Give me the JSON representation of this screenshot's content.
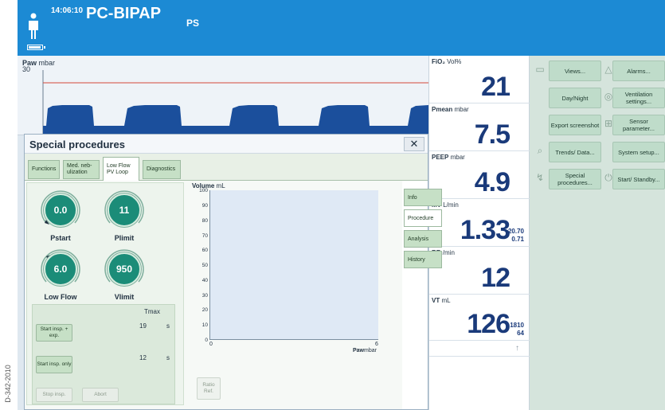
{
  "side_caption": "D-342-2010",
  "header": {
    "time": "14:06:10",
    "mode": "PC-BIPAP",
    "sub_mode": "PS"
  },
  "curve": {
    "param": "Paw",
    "unit": "mbar",
    "scale_max": "30",
    "limit_color": "#d44a3a",
    "wave_color": "#1b4f9c"
  },
  "values": [
    {
      "param": "FiO₂",
      "unit": "Vol%",
      "value": "21",
      "small": []
    },
    {
      "param": "Pmean",
      "unit": "mbar",
      "value": "7.5",
      "small": []
    },
    {
      "param": "PEEP",
      "unit": "mbar",
      "value": "4.9",
      "small": []
    },
    {
      "param": "MV",
      "unit": "L/min",
      "value": "1.33",
      "small": [
        "20.70",
        "0.71"
      ]
    },
    {
      "param": "RR",
      "unit": "/min",
      "value": "12",
      "small": []
    },
    {
      "param": "VT",
      "unit": "mL",
      "value": "126",
      "small": [
        "1810",
        "64"
      ]
    }
  ],
  "values_arrow": "↑",
  "right_panel": {
    "buttons": [
      {
        "label": "Views...",
        "icon": "views-icon"
      },
      {
        "label": "Alarms...",
        "icon": "alarm-icon"
      },
      {
        "label": "Day/Night",
        "icon": ""
      },
      {
        "label": "Ventilation settings...",
        "icon": "ventilation-icon"
      },
      {
        "label": "Export screenshot",
        "icon": ""
      },
      {
        "label": "Sensor parameter...",
        "icon": "sensor-icon"
      },
      {
        "label": "Trends/ Data...",
        "icon": "trends-icon"
      },
      {
        "label": "System setup...",
        "icon": ""
      },
      {
        "label": "Special procedures...",
        "icon": "procedures-icon"
      },
      {
        "label": "Start/ Standby...",
        "icon": "power-icon"
      }
    ]
  },
  "dialog": {
    "title": "Special procedures",
    "close": "✕",
    "tabs": [
      "Functions",
      "Med. neb- ulization",
      "Low Flow PV Loop",
      "Diagnostics"
    ],
    "active_tab": 2,
    "side_tabs": [
      "Info",
      "Procedure",
      "Analysis",
      "History"
    ],
    "active_side_tab": 1,
    "dials": [
      {
        "value": "0.0",
        "label": "Pstart"
      },
      {
        "value": "11",
        "label": "Plimit"
      },
      {
        "value": "6.0",
        "label": "Low Flow"
      },
      {
        "value": "950",
        "label": "Vlimit"
      }
    ],
    "tmax_label": "Tmax",
    "start_insp_exp": "Start insp. + exp.",
    "start_insp_only": "Start insp. only",
    "tmax_1": "19",
    "tmax_2": "12",
    "tmax_unit": "s",
    "stop_insp": "Stop insp.",
    "abort": "Abort",
    "ratio_ref": "Ratio Ref."
  },
  "pv_chart": {
    "y_label": "Volume",
    "y_unit": "mL",
    "x_label": "Paw",
    "x_unit": "mbar",
    "y_ticks": [
      "100",
      "90",
      "80",
      "70",
      "60",
      "50",
      "40",
      "30",
      "20",
      "10",
      "0"
    ],
    "x_ticks": [
      "0",
      "6"
    ]
  }
}
